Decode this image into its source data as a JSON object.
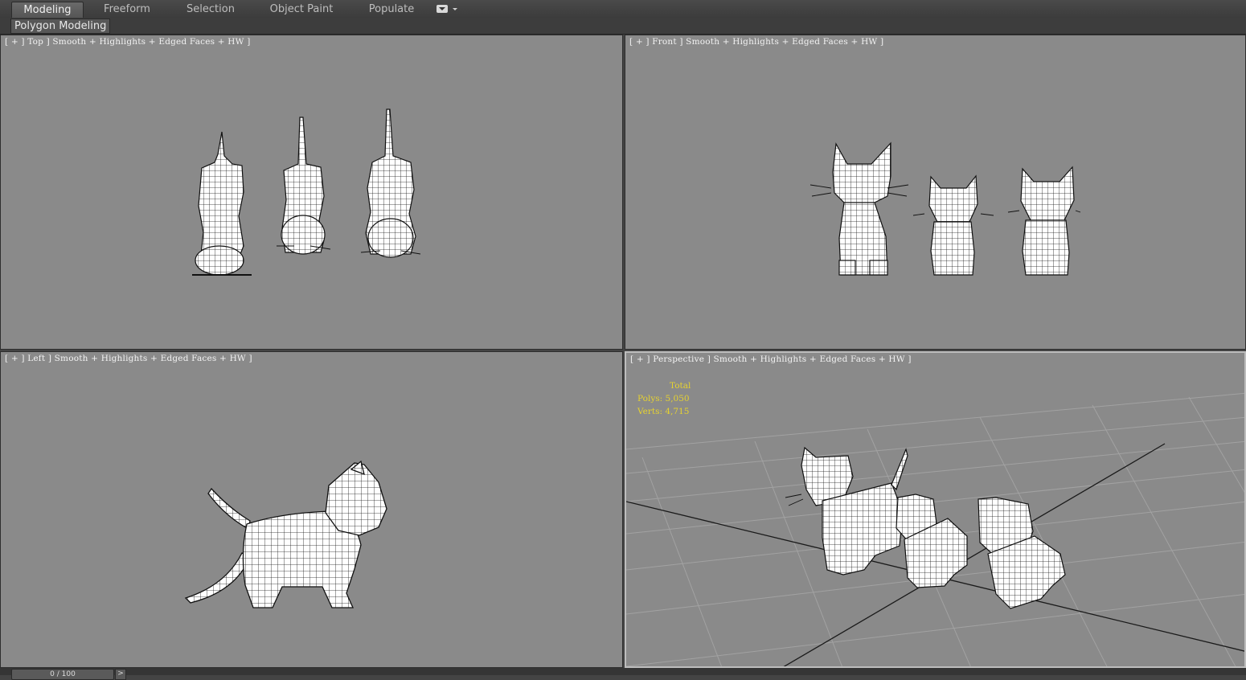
{
  "ribbon": {
    "tabs": [
      "Modeling",
      "Freeform",
      "Selection",
      "Object Paint",
      "Populate"
    ],
    "active_tab": "Modeling",
    "panel_label": "Polygon Modeling"
  },
  "viewports": {
    "top": {
      "label": "[ + ] Top ] Smooth + Highlights + Edged Faces + HW ]"
    },
    "front": {
      "label": "[ + ] Front ] Smooth + Highlights + Edged Faces + HW ]"
    },
    "left": {
      "label": "[ + ] Left ] Smooth + Highlights + Edged Faces + HW ]"
    },
    "perspective": {
      "label": "[ + ] Perspective ] Smooth + Highlights + Edged Faces + HW ]",
      "stats": {
        "total": "Total",
        "polys": "Polys: 5,050",
        "verts": "Verts: 4,715"
      }
    }
  },
  "timeline": {
    "frame": "0 / 100",
    "next": ">"
  },
  "colors": {
    "viewport_bg": "#8a8a8a",
    "stats_text": "#e6d230",
    "label_text": "#f2f2f2",
    "ui_dark": "#444444"
  }
}
